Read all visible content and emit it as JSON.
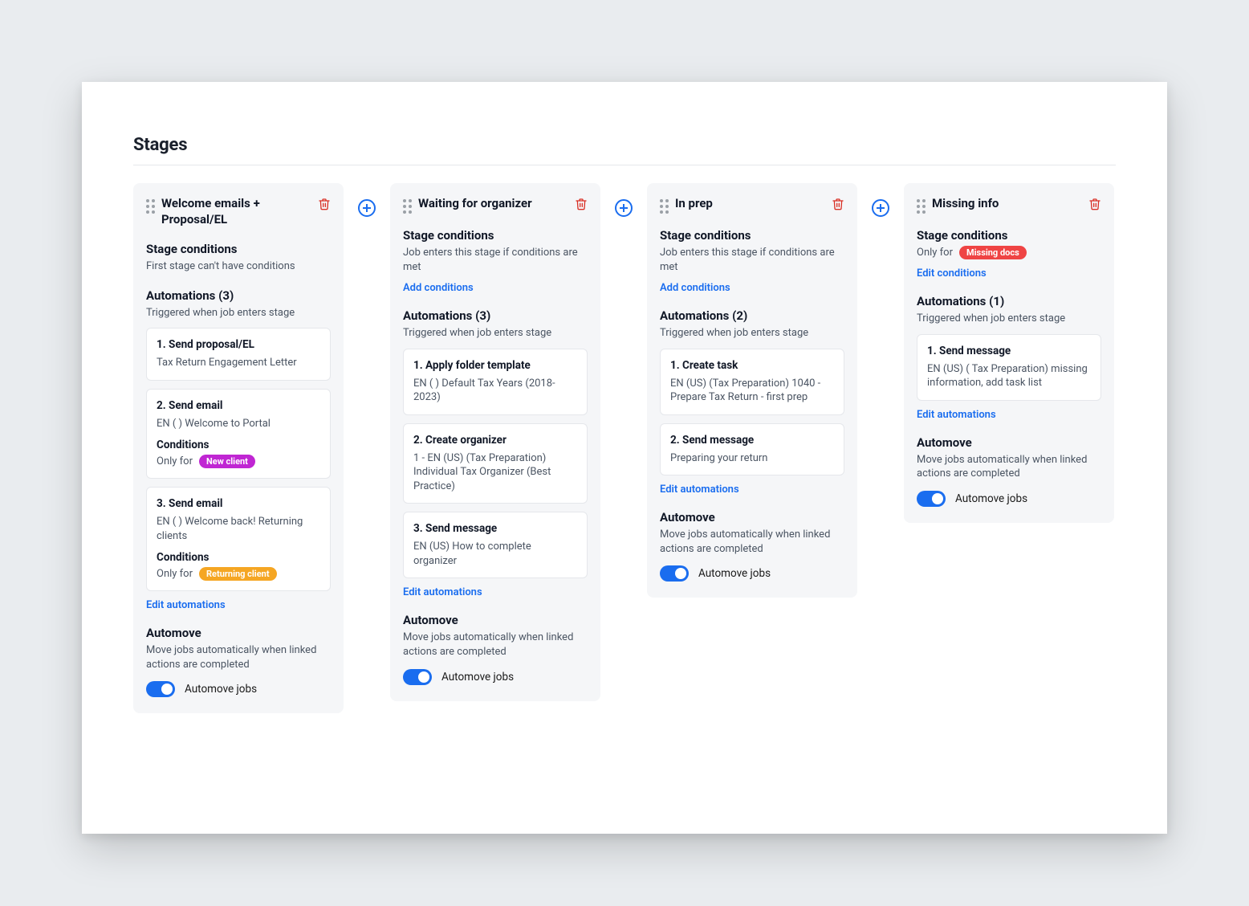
{
  "page": {
    "title": "Stages"
  },
  "common": {
    "conditions_header": "Stage conditions",
    "add_conditions": "Add conditions",
    "edit_conditions": "Edit conditions",
    "automove_header": "Automove",
    "automove_desc": "Move jobs automatically when linked actions are completed",
    "automove_toggle_label": "Automove jobs",
    "edit_automations": "Edit automations",
    "automations_trigger_desc": "Triggered when job enters stage",
    "conditions_only_for": "Only for",
    "cond_enters_if_met": "Job enters this stage if conditions are met"
  },
  "stage1": {
    "title": "Welcome emails + Proposal/EL",
    "cond_desc": "First stage can't have conditions",
    "automations_header": "Automations (3)",
    "a1": {
      "title": "1. Send proposal/EL",
      "body": "Tax Return Engagement Letter"
    },
    "a2": {
      "title": "2. Send email",
      "body": "EN ( ) Welcome to Portal",
      "cond_header": "Conditions",
      "pill": "New client"
    },
    "a3": {
      "title": "3. Send email",
      "body": "EN ( ) Welcome back! Returning clients",
      "cond_header": "Conditions",
      "pill": "Returning client"
    }
  },
  "stage2": {
    "title": "Waiting for organizer",
    "automations_header": "Automations (3)",
    "a1": {
      "title": "1. Apply folder template",
      "body": "EN ( ) Default Tax Years (2018-2023)"
    },
    "a2": {
      "title": "2. Create organizer",
      "body": "1 - EN (US) (Tax Preparation) Individual Tax Organizer (Best Practice)"
    },
    "a3": {
      "title": "3. Send message",
      "body": "EN (US) How to complete organizer"
    }
  },
  "stage3": {
    "title": "In prep",
    "automations_header": "Automations (2)",
    "a1": {
      "title": "1. Create task",
      "body": "EN (US) (Tax Preparation) 1040 - Prepare Tax Return - first prep"
    },
    "a2": {
      "title": "2. Send message",
      "body": "Preparing your return"
    }
  },
  "stage4": {
    "title": "Missing info",
    "cond_pill": "Missing docs",
    "automations_header": "Automations (1)",
    "a1": {
      "title": "1. Send message",
      "body": "EN (US) ( Tax Preparation) missing information, add task list"
    }
  }
}
